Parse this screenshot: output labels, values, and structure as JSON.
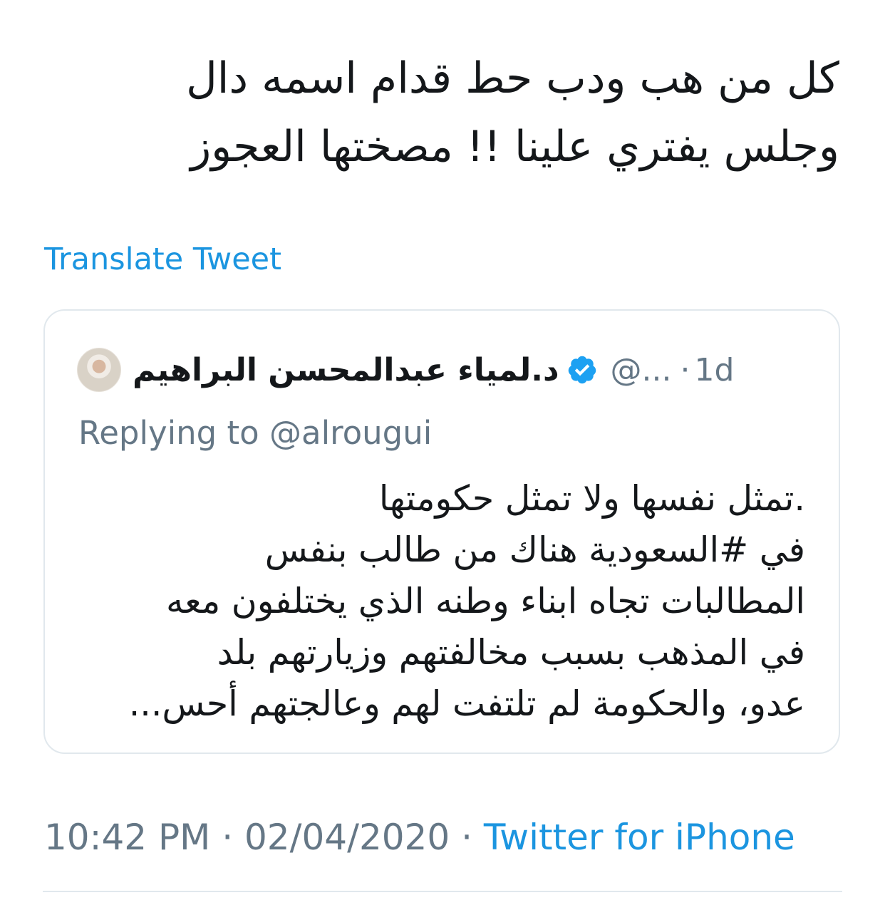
{
  "tweet": {
    "text_lines": [
      "كل من هب ودب حط  قدام اسمه دال",
      "وجلس يفتري علينا !! مصختها العجوز"
    ],
    "translate_label": "Translate Tweet"
  },
  "quoted_tweet": {
    "display_name": "د.لمياء عبدالمحسن البراهيم",
    "handle": "@...",
    "separator": "·",
    "time": "1d",
    "replying_prefix": "Replying to",
    "replying_to": "@alrougui",
    "text_lines": [
      ".تمثل نفسها ولا تمثل حكومتها",
      "في #السعودية هناك من طالب بنفس",
      "المطالبات تجاه ابناء وطنه الذي يختلفون معه",
      "في المذهب بسبب مخالفتهم وزيارتهم بلد",
      "عدو، والحكومة لم تلتفت لهم وعالجتهم أحس..."
    ],
    "verified_icon": "verified-badge-icon"
  },
  "meta": {
    "time": "10:42 PM",
    "separator": "·",
    "date": "02/04/2020",
    "source": "Twitter for iPhone"
  },
  "colors": {
    "link": "#1b95e0",
    "secondary_text": "#657786",
    "border": "#e1e8ed",
    "primary_text": "#14171a"
  }
}
